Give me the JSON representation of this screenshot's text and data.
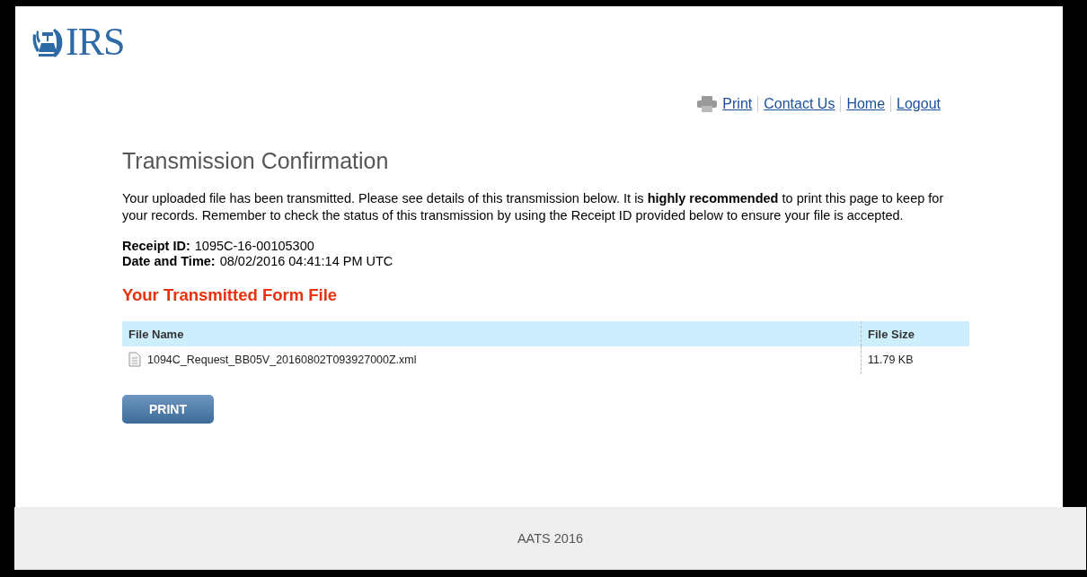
{
  "header": {
    "logo_text": "IRS"
  },
  "top_links": [
    {
      "label": "Print",
      "kind": "print"
    },
    {
      "label": "Contact Us",
      "kind": "link"
    },
    {
      "label": "Home",
      "kind": "link"
    },
    {
      "label": "Logout",
      "kind": "link"
    }
  ],
  "title": "Transmission Confirmation",
  "intro": "Your uploaded file has been transmitted. Please see details of this transmission below. It is **highly recommended** to print this page to keep for your records. Remember to check the status of this transmission by using the Receipt ID provided below to ensure your file is accepted.",
  "details": [
    {
      "label": "Receipt ID:",
      "value": "1095C-16-00105300"
    },
    {
      "label": "Date and Time:",
      "value": "08/02/2016 04:41:14 PM UTC"
    }
  ],
  "section_title": "Your Transmitted Form File",
  "table": {
    "columns": [
      "File Name",
      "File Size"
    ],
    "rows": [
      {
        "file_name": "1094C_Request_BB05V_20160802T093927000Z.xml",
        "file_size": "11.79 KB"
      }
    ]
  },
  "button": "PRINT",
  "footer": "AATS 2016"
}
